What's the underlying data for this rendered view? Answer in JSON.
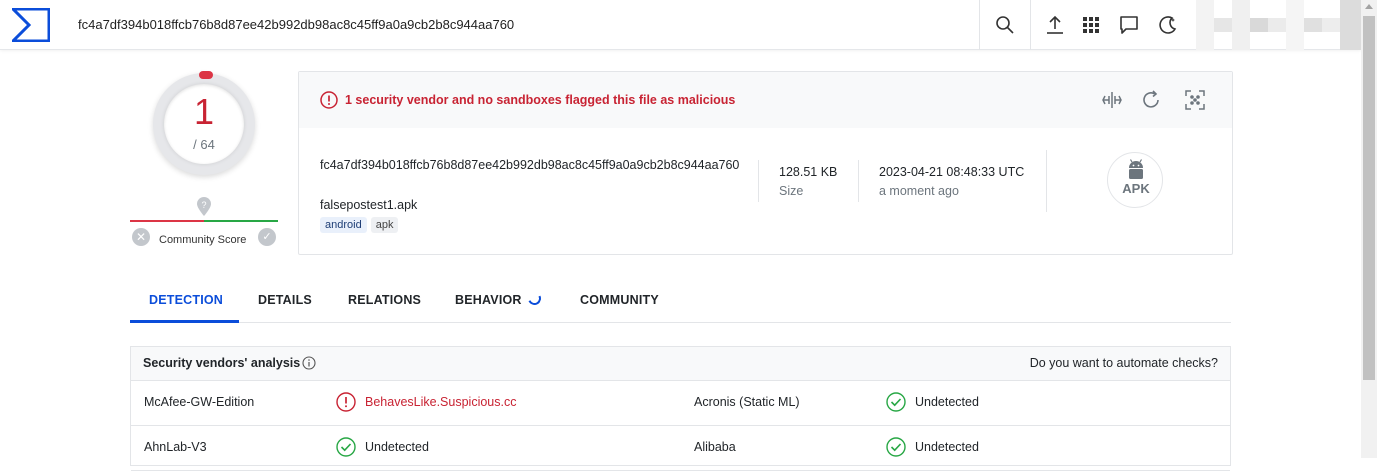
{
  "header": {
    "logo_icon": "virustotal-sigma-logo",
    "search_value": "fc4a7df394b018ffcb76b8d87ee42b992db98ac8c45ff9a0a9cb2b8c944aa760",
    "icons": [
      "search-icon",
      "upload-icon",
      "apps-grid-icon",
      "chat-icon",
      "dark-mode-icon"
    ]
  },
  "score": {
    "detections": "1",
    "total": "/ 64",
    "community_label": "Community Score"
  },
  "summary": {
    "alert_text": "1 security vendor and no sandboxes flagged this file as malicious",
    "hash": "fc4a7df394b018ffcb76b8d87ee42b992db98ac8c45ff9a0a9cb2b8c944aa760",
    "filename": "falsepostest1.apk",
    "tags": [
      "android",
      "apk"
    ],
    "size_value": "128.51 KB",
    "size_label": "Size",
    "date_value": "2023-04-21 08:48:33 UTC",
    "date_label": "a moment ago",
    "file_type": "APK"
  },
  "tabs": [
    {
      "label": "DETECTION",
      "active": true
    },
    {
      "label": "DETAILS",
      "active": false
    },
    {
      "label": "RELATIONS",
      "active": false
    },
    {
      "label": "BEHAVIOR",
      "active": false
    },
    {
      "label": "COMMUNITY",
      "active": false
    }
  ],
  "analysis": {
    "title": "Security vendors' analysis",
    "automate_text": "Do you want to automate checks?",
    "rows": [
      {
        "left_vendor": "McAfee-GW-Edition",
        "left_result": "BehavesLike.Suspicious.cc",
        "left_malicious": true,
        "right_vendor": "Acronis (Static ML)",
        "right_result": "Undetected",
        "right_malicious": false
      },
      {
        "left_vendor": "AhnLab-V3",
        "left_result": "Undetected",
        "left_malicious": false,
        "right_vendor": "Alibaba",
        "right_result": "Undetected",
        "right_malicious": false
      }
    ]
  },
  "colors": {
    "accent": "#0b4dda",
    "malicious": "#c82333",
    "clean": "#28a745",
    "tag_bg": "#e9f0fb"
  }
}
